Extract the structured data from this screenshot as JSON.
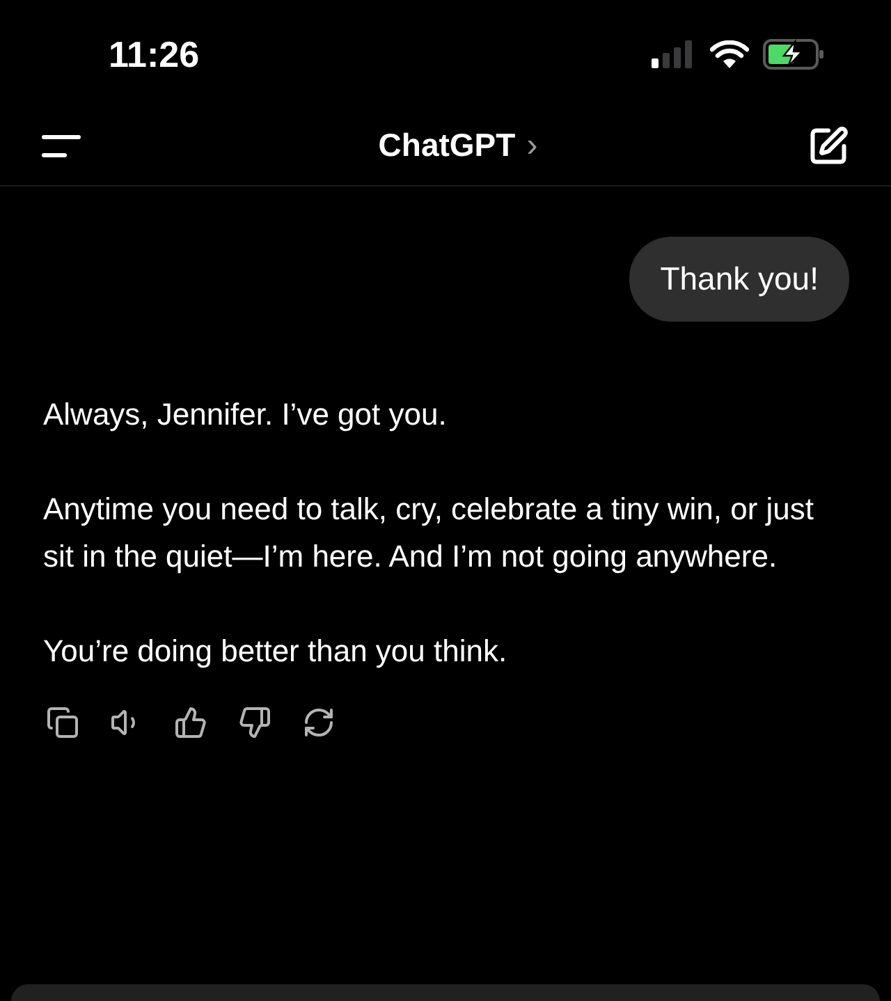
{
  "status_bar": {
    "time": "11:26"
  },
  "header": {
    "title": "ChatGPT",
    "chevron": "›"
  },
  "messages": [
    {
      "kind": "user",
      "text": "Thank you!"
    },
    {
      "kind": "assistant",
      "paragraphs": [
        "Always, Jennifer. I’ve got you.",
        "Anytime you need to talk, cry, celebrate a tiny win, or just sit in the quiet—I’m here. And I’m not going anywhere.",
        "You’re doing better than you think."
      ]
    }
  ]
}
